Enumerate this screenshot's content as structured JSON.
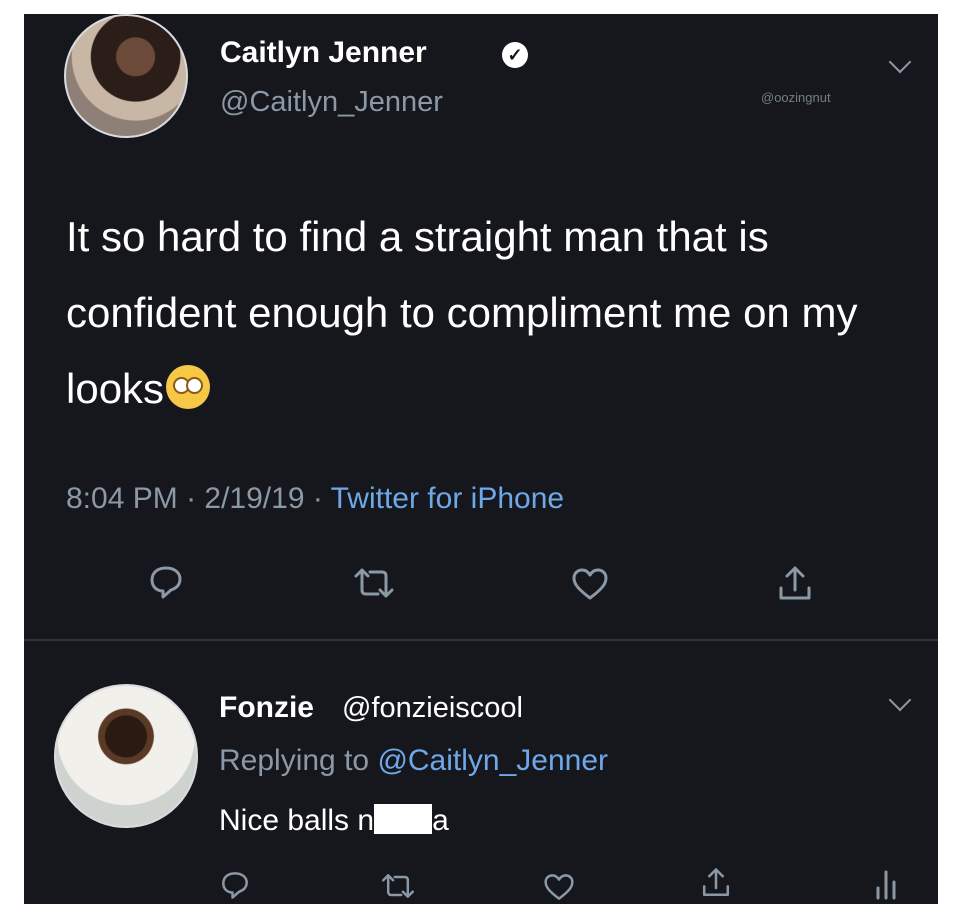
{
  "tweet": {
    "author_name": "Caitlyn Jenner",
    "author_handle": "@Caitlyn_Jenner",
    "watermark": "@oozingnut",
    "text": "It so hard to find a straight man that is confident enough to compliment me on my looks",
    "emoji": "face-with-rolling-eyes",
    "time": "8:04 PM",
    "date": "2/19/19",
    "source": "Twitter for iPhone",
    "separator": " · "
  },
  "reply": {
    "author_name": "Fonzie",
    "author_handle": "@fonzieiscool",
    "replying_prefix": "Replying to ",
    "replying_to": "@Caitlyn_Jenner",
    "text_start": "Nice balls n",
    "text_end": "a"
  },
  "icons": {
    "reply": "reply-icon",
    "retweet": "retweet-icon",
    "like": "heart-icon",
    "share": "share-icon",
    "analytics": "analytics-icon",
    "more": "chevron-down-icon",
    "verified": "verified-badge-icon"
  },
  "colors": {
    "background": "#15171d",
    "text": "#ffffff",
    "muted": "#8b98a5",
    "link": "#6ea8e8"
  }
}
